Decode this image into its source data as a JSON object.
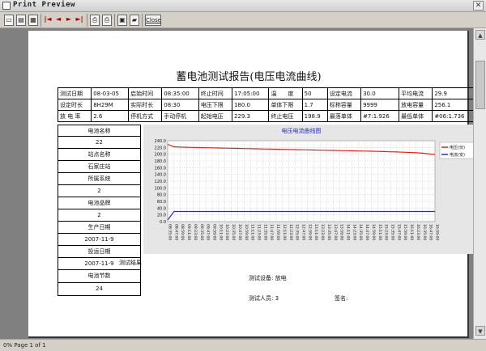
{
  "window": {
    "title": "Print Preview",
    "close_glyph": "✕"
  },
  "toolbar": {
    "icons": [
      "page-width-icon",
      "one-page-icon",
      "multi-page-icon",
      "first-page-icon",
      "prev-page-icon",
      "next-page-icon",
      "last-page-icon",
      "print-setup-icon",
      "print-icon",
      "save-icon",
      "open-icon"
    ],
    "first": "|◄",
    "prev": "◄",
    "next": "►",
    "last": "►|",
    "close_label": "Close"
  },
  "statusbar": {
    "text": "0% Page 1 of 1"
  },
  "report": {
    "title": "蓄电池测试报告(电压电流曲线)",
    "rows": [
      [
        "测试日期",
        "08-03-05",
        "启始时间",
        "08:35:00",
        "终止时间",
        "17:05:00",
        "温　　度",
        "50",
        "设定电流",
        "30.0",
        "平均电流",
        "29.9"
      ],
      [
        "设定时长",
        "8H29M",
        "实际时长",
        "08:30",
        "电压下限",
        "180.0",
        "单体下限",
        "1.7",
        "标称容量",
        "9999",
        "放电容量",
        "256.1"
      ],
      [
        "放 电 率",
        "2.6",
        "停机方式",
        "手动停机",
        "起始电压",
        "229.3",
        "终止电压",
        "198.9",
        "最落单体",
        "#7:1.926",
        "最低单体",
        "#06:1.736"
      ]
    ],
    "side": [
      "电池名称",
      "22",
      "站点名称",
      "石家庄站",
      "所属系统",
      "2",
      "电池品牌",
      "2",
      "生产日期",
      "2007-11-9",
      "投运日期",
      "2007-11-9",
      "电池节数",
      "24"
    ],
    "test_result_label": "测试结果",
    "device_label": "测试设备: 放电",
    "person_label": "测试人员: 3",
    "sign_label": "签名:"
  },
  "chart_data": {
    "type": "line",
    "title": "电压电流曲线图",
    "ylim": [
      0,
      240
    ],
    "yticks": [
      "0.0",
      "20.0",
      "40.0",
      "60.0",
      "80.0",
      "100.0",
      "120.0",
      "140.0",
      "160.0",
      "180.0",
      "200.0",
      "220.0",
      "240.0"
    ],
    "categories": [
      "08:35:00",
      "08:47:00",
      "08:59:00",
      "09:11:00",
      "09:23:00",
      "09:35:00",
      "09:47:00",
      "09:59:00",
      "10:11:00",
      "10:23:00",
      "10:35:00",
      "10:47:00",
      "10:59:00",
      "11:11:00",
      "11:23:00",
      "11:35:00",
      "11:47:00",
      "11:59:00",
      "12:11:00",
      "12:23:00",
      "12:35:00",
      "12:47:00",
      "12:59:00",
      "13:11:00",
      "13:23:00",
      "13:35:00",
      "13:47:00",
      "13:59:00",
      "14:11:00",
      "14:23:00",
      "14:35:00",
      "14:47:00",
      "14:59:00",
      "15:11:00",
      "15:23:00",
      "15:35:00",
      "15:47:00",
      "15:59:00",
      "16:11:00",
      "16:23:00",
      "16:35:00",
      "16:47:00",
      "16:59:00"
    ],
    "series": [
      {
        "name": "电压(伏)",
        "color": "#e0201a",
        "values": [
          229.3,
          222,
          221,
          220.5,
          220,
          219.6,
          219.2,
          218.8,
          218.4,
          218,
          217.6,
          217.2,
          216.8,
          216.4,
          216,
          215.6,
          215.2,
          214.8,
          214.4,
          214,
          213.6,
          213.2,
          212.8,
          212.4,
          212,
          211.6,
          211.2,
          210.8,
          210.4,
          210,
          209.6,
          209.2,
          208.8,
          208.3,
          207.8,
          207.2,
          206.6,
          206,
          205.2,
          204.3,
          203,
          201.2,
          198.9
        ]
      },
      {
        "name": "电流(安)",
        "color": "#2030c0",
        "values": [
          5,
          29.9,
          29.9,
          29.9,
          29.9,
          29.9,
          29.9,
          29.9,
          29.9,
          29.9,
          29.9,
          29.9,
          29.9,
          29.9,
          29.9,
          29.9,
          29.9,
          29.9,
          29.9,
          29.9,
          29.9,
          29.9,
          29.9,
          29.9,
          29.9,
          29.9,
          29.9,
          29.9,
          29.9,
          29.9,
          29.9,
          29.9,
          29.9,
          29.9,
          29.9,
          29.9,
          29.9,
          29.9,
          29.9,
          29.9,
          29.9,
          29.9,
          29.9
        ]
      }
    ],
    "grid": true,
    "legend": "top-right"
  }
}
